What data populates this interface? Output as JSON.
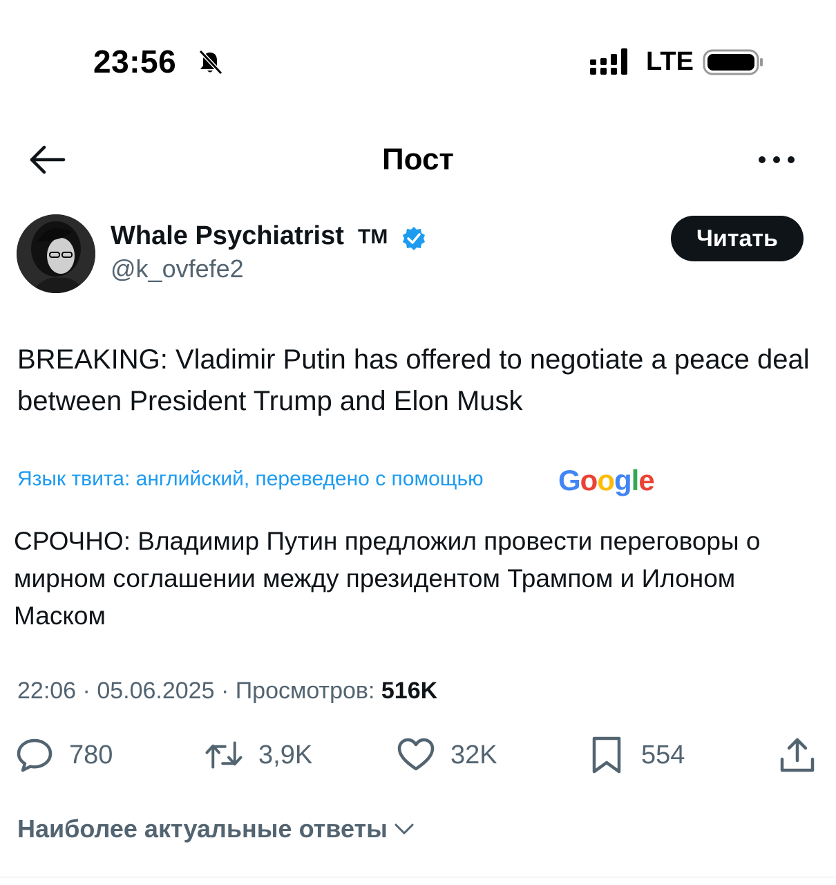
{
  "status_bar": {
    "time": "23:56",
    "network": "LTE"
  },
  "header": {
    "title": "Пост"
  },
  "author": {
    "name": "Whale Psychiatrist",
    "name_suffix": "TM",
    "handle": "@k_ovfefe2",
    "follow_label": "Читать"
  },
  "tweet": {
    "text": "BREAKING: Vladimir Putin has offered to negotiate a peace deal between President Trump and Elon Musk",
    "translation_note": "Язык твита: английский, переведено с помощью",
    "translated_text": "СРОЧНО: Владимир Путин предложил провести переговоры о мирном соглашении между президентом Трампом и Илоном Маском",
    "time": "22:06",
    "date": "05.06.2025",
    "views_label": "Просмотров:",
    "views_value": "516K"
  },
  "google_logo": {
    "letters": [
      "G",
      "o",
      "o",
      "g",
      "l",
      "e"
    ],
    "colors": [
      "#4285F4",
      "#EA4335",
      "#FBBC05",
      "#4285F4",
      "#34A853",
      "#EA4335"
    ]
  },
  "actions": {
    "replies": "780",
    "reposts": "3,9K",
    "likes": "32K",
    "bookmarks": "554"
  },
  "replies_sort": {
    "label": "Наиболее актуальные ответы"
  },
  "colors": {
    "link": "#1d9bf0",
    "secondary_text": "#536471",
    "primary_text": "#0f1419"
  }
}
